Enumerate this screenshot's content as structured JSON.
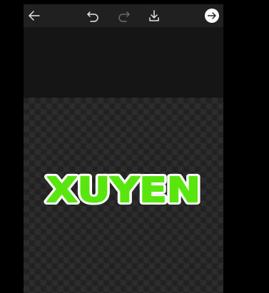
{
  "toolbar": {
    "back_icon": "arrow-left-icon",
    "undo_icon": "undo-icon",
    "redo_icon": "redo-icon",
    "download_icon": "download-icon",
    "next_icon": "arrow-right-circle-icon"
  },
  "canvas": {
    "sticker_text": "XUYEN",
    "fill_color": "#59e60f",
    "outline_color": "#ffffff",
    "background": "transparent-checkerboard"
  },
  "colors": {
    "page_background": "#000000",
    "panel_background": "#151515",
    "toolbar_background": "#202020",
    "icon_active": "#e6e6e6",
    "icon_disabled": "#6a6a6a"
  }
}
